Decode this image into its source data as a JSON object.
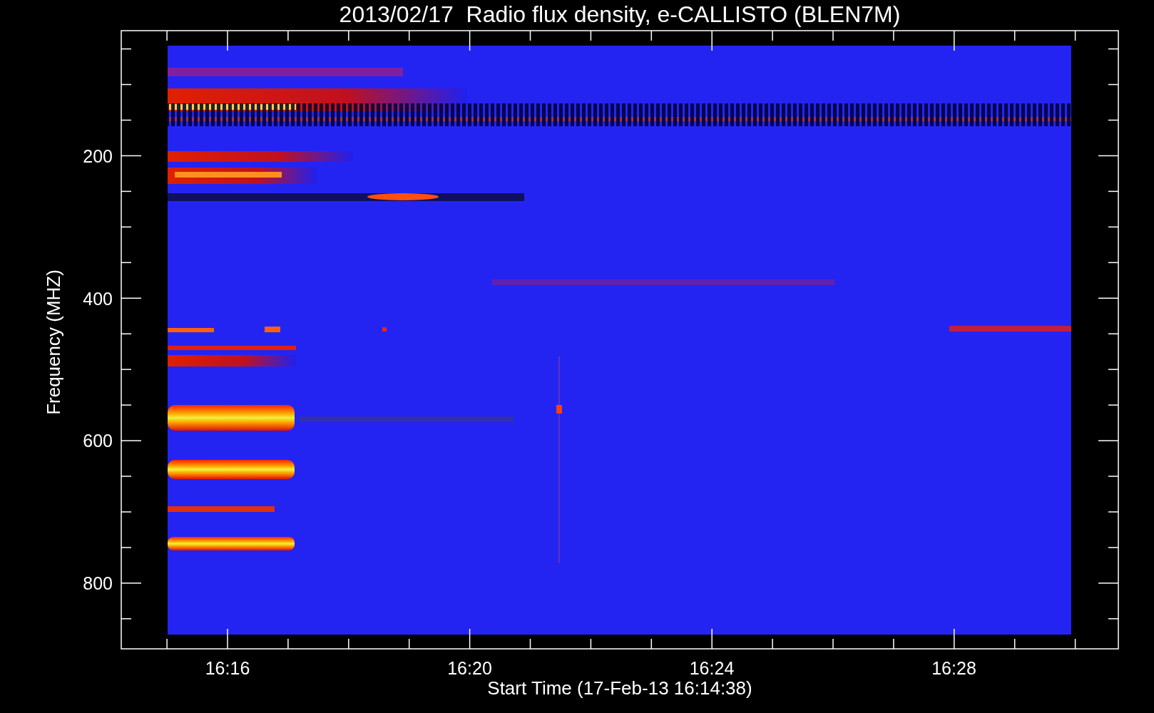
{
  "title": "2013/02/17  Radio flux density, e-CALLISTO (BLEN7M)",
  "x_axis": {
    "label": "Start Time (17-Feb-13 16:14:38)",
    "ticks": [
      "16:16",
      "16:20",
      "16:24",
      "16:28"
    ]
  },
  "y_axis": {
    "label": "Frequency (MHZ)",
    "ticks": [
      "200",
      "400",
      "600",
      "800"
    ]
  }
}
